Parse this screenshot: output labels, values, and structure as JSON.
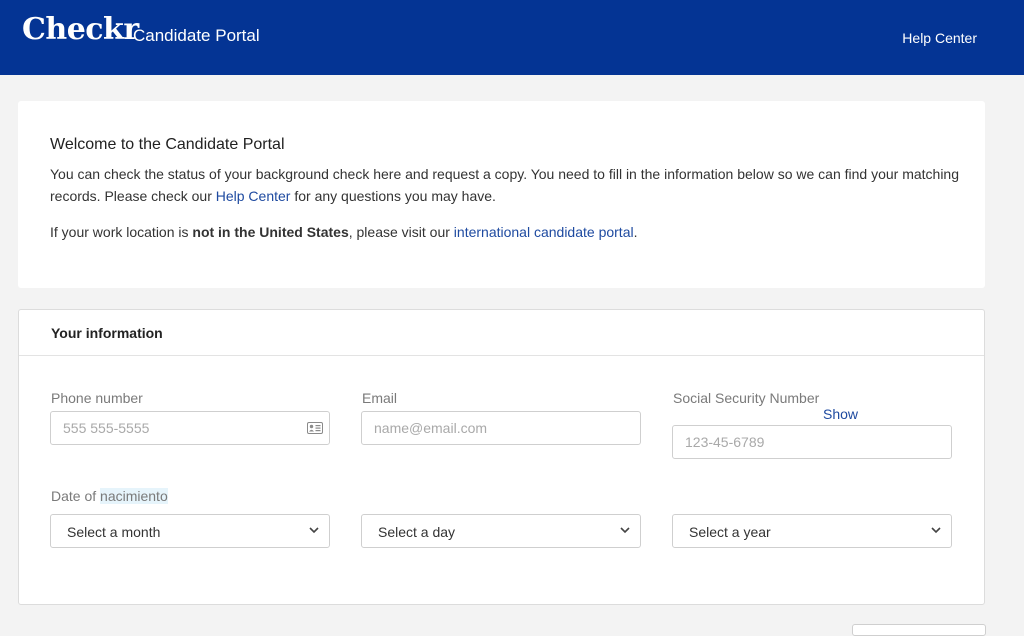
{
  "header": {
    "logo": "Checkr",
    "title": "Candidate Portal",
    "help_link": "Help Center"
  },
  "welcome": {
    "heading": "Welcome to the Candidate Portal",
    "p1_before": "You can check the status of your background check here and request a copy. You need to fill in the information below so we can find your matching records. Please check our ",
    "p1_link": "Help Center",
    "p1_after": " for any questions you may have.",
    "p2_before": "If your work location is ",
    "p2_bold": "not in the United States",
    "p2_middle": ", please visit our ",
    "p2_link": "international candidate portal",
    "p2_after": "."
  },
  "info": {
    "title": "Your information",
    "phone": {
      "label": "Phone number",
      "placeholder": "555 555-5555",
      "icon": "contact-card-icon"
    },
    "email": {
      "label": "Email",
      "placeholder": "name@email.com"
    },
    "ssn": {
      "label": "Social Security Number",
      "show": "Show",
      "placeholder": "123-45-6789"
    },
    "dob": {
      "label_prefix": "Date of ",
      "label_highlight": "nacimiento",
      "month": "Select a month",
      "day": "Select a day",
      "year": "Select a year"
    }
  },
  "colors": {
    "header_bg": "#043494",
    "link": "#1e4aa0",
    "page_bg": "#f3f3f3"
  }
}
